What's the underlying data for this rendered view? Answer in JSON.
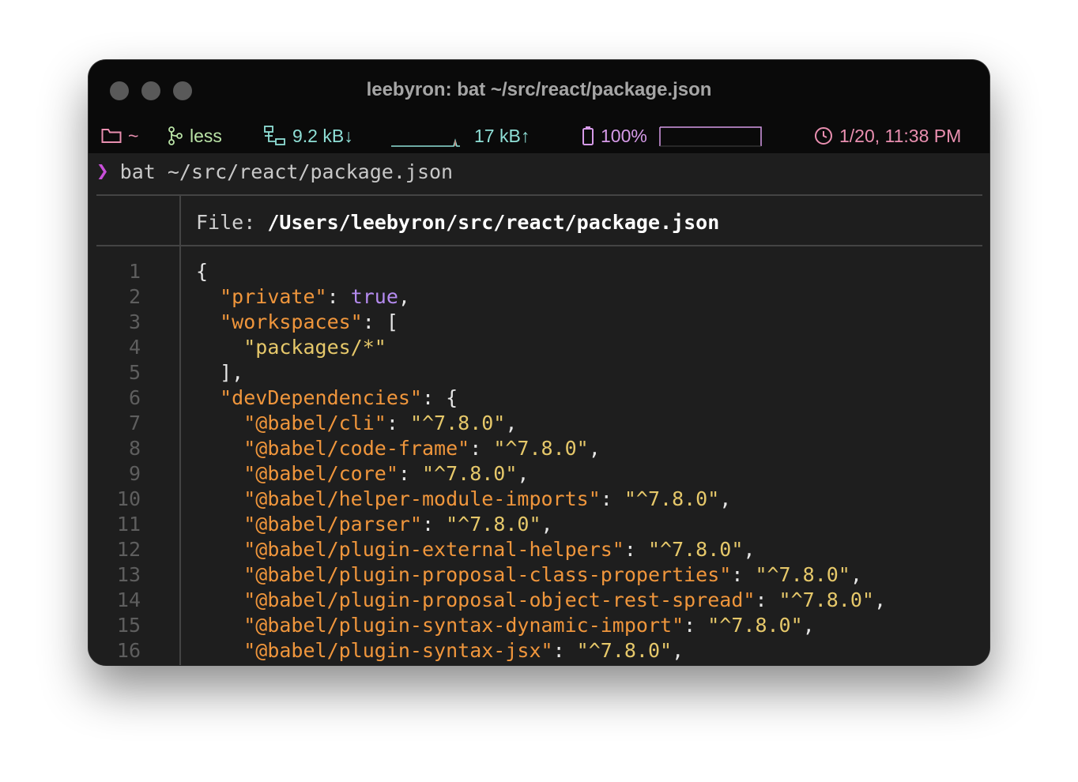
{
  "window": {
    "title": "leebyron: bat ~/src/react/package.json"
  },
  "statusbar": {
    "folder": "~",
    "branch": "less",
    "download": "9.2 kB↓",
    "upload": "17 kB↑",
    "battery": "100%",
    "battery_level": 1.0,
    "clock": "1/20, 11:38 PM"
  },
  "colors": {
    "folder": "#e98fb0",
    "branch": "#b9e3a6",
    "network": "#8fdfd6",
    "battery": "#d69ae8",
    "clock": "#e98fb0",
    "prompt_arrow": "#c84fd9",
    "json_key": "#f0963c",
    "json_string": "#e6c86a",
    "json_bool": "#b58bf0"
  },
  "terminal": {
    "prompt_symbol": "❯",
    "command": "bat ~/src/react/package.json",
    "file_label": "File: ",
    "file_path": "/Users/leebyron/src/react/package.json",
    "line_numbers": [
      "1",
      "2",
      "3",
      "4",
      "5",
      "6",
      "7",
      "8",
      "9",
      "10",
      "11",
      "12",
      "13",
      "14",
      "15",
      "16"
    ],
    "code_lines": [
      [
        [
          "p",
          "{"
        ]
      ],
      [
        [
          "p",
          "  "
        ],
        [
          "k",
          "\"private\""
        ],
        [
          "p",
          ": "
        ],
        [
          "b",
          "true"
        ],
        [
          "p",
          ","
        ]
      ],
      [
        [
          "p",
          "  "
        ],
        [
          "k",
          "\"workspaces\""
        ],
        [
          "p",
          ": ["
        ]
      ],
      [
        [
          "p",
          "    "
        ],
        [
          "s",
          "\"packages/*\""
        ]
      ],
      [
        [
          "p",
          "  ],"
        ]
      ],
      [
        [
          "p",
          "  "
        ],
        [
          "k",
          "\"devDependencies\""
        ],
        [
          "p",
          ": {"
        ]
      ],
      [
        [
          "p",
          "    "
        ],
        [
          "k",
          "\"@babel/cli\""
        ],
        [
          "p",
          ": "
        ],
        [
          "s",
          "\"^7.8.0\""
        ],
        [
          "p",
          ","
        ]
      ],
      [
        [
          "p",
          "    "
        ],
        [
          "k",
          "\"@babel/code-frame\""
        ],
        [
          "p",
          ": "
        ],
        [
          "s",
          "\"^7.8.0\""
        ],
        [
          "p",
          ","
        ]
      ],
      [
        [
          "p",
          "    "
        ],
        [
          "k",
          "\"@babel/core\""
        ],
        [
          "p",
          ": "
        ],
        [
          "s",
          "\"^7.8.0\""
        ],
        [
          "p",
          ","
        ]
      ],
      [
        [
          "p",
          "    "
        ],
        [
          "k",
          "\"@babel/helper-module-imports\""
        ],
        [
          "p",
          ": "
        ],
        [
          "s",
          "\"^7.8.0\""
        ],
        [
          "p",
          ","
        ]
      ],
      [
        [
          "p",
          "    "
        ],
        [
          "k",
          "\"@babel/parser\""
        ],
        [
          "p",
          ": "
        ],
        [
          "s",
          "\"^7.8.0\""
        ],
        [
          "p",
          ","
        ]
      ],
      [
        [
          "p",
          "    "
        ],
        [
          "k",
          "\"@babel/plugin-external-helpers\""
        ],
        [
          "p",
          ": "
        ],
        [
          "s",
          "\"^7.8.0\""
        ],
        [
          "p",
          ","
        ]
      ],
      [
        [
          "p",
          "    "
        ],
        [
          "k",
          "\"@babel/plugin-proposal-class-properties\""
        ],
        [
          "p",
          ": "
        ],
        [
          "s",
          "\"^7.8.0\""
        ],
        [
          "p",
          ","
        ]
      ],
      [
        [
          "p",
          "    "
        ],
        [
          "k",
          "\"@babel/plugin-proposal-object-rest-spread\""
        ],
        [
          "p",
          ": "
        ],
        [
          "s",
          "\"^7.8.0\""
        ],
        [
          "p",
          ","
        ]
      ],
      [
        [
          "p",
          "    "
        ],
        [
          "k",
          "\"@babel/plugin-syntax-dynamic-import\""
        ],
        [
          "p",
          ": "
        ],
        [
          "s",
          "\"^7.8.0\""
        ],
        [
          "p",
          ","
        ]
      ],
      [
        [
          "p",
          "    "
        ],
        [
          "k",
          "\"@babel/plugin-syntax-jsx\""
        ],
        [
          "p",
          ": "
        ],
        [
          "s",
          "\"^7.8.0\""
        ],
        [
          "p",
          ","
        ]
      ]
    ]
  }
}
